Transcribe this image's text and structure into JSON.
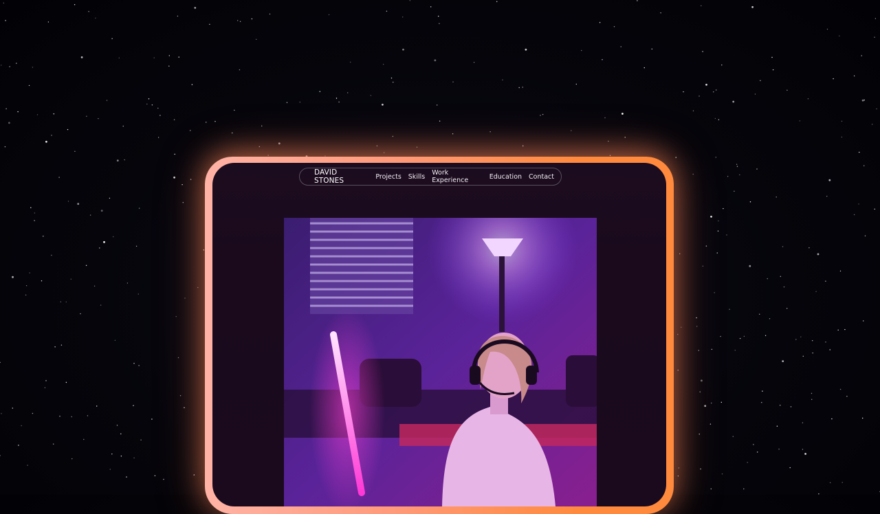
{
  "navbar": {
    "brand": "DAVID STONES",
    "links": [
      "Projects",
      "Skills",
      "Work Experience",
      "Education",
      "Contact"
    ]
  },
  "hero_image": {
    "description_icon": "person-with-headset-neon-room-image"
  },
  "colors": {
    "frame_glow": "#ff9a7a",
    "frame_accent": "#ff8a3d",
    "screen_bg": "#1c0c1f",
    "neon_pink": "#ff4fe0",
    "room_purple": "#5a1f8e"
  }
}
